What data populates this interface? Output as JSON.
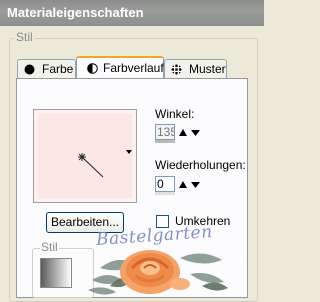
{
  "window": {
    "title": "Materialeigenschaften"
  },
  "group": {
    "label": "Stil"
  },
  "tabs": [
    {
      "label": "Farbe",
      "icon": "filled-circle-icon",
      "active": false
    },
    {
      "label": "Farbverlauf",
      "icon": "half-circle-icon",
      "active": true
    },
    {
      "label": "Muster",
      "icon": "pattern-icon",
      "active": false
    }
  ],
  "gradient_panel": {
    "angle_label": "Winkel:",
    "angle_value": "135",
    "repeats_label": "Wiederholungen:",
    "repeats_value": "0",
    "edit_button": "Bearbeiten...",
    "invert_label": "Umkehren",
    "invert_checked": false,
    "style_label": "Stil"
  },
  "watermark": {
    "text": "Bastelgarten"
  },
  "colors": {
    "titlebar": "#8e908e",
    "tab_highlight": "#f5a623",
    "swatch": "#fbe7e4",
    "watermark_text": "#7a86c2",
    "rose": "#f08a4a"
  }
}
